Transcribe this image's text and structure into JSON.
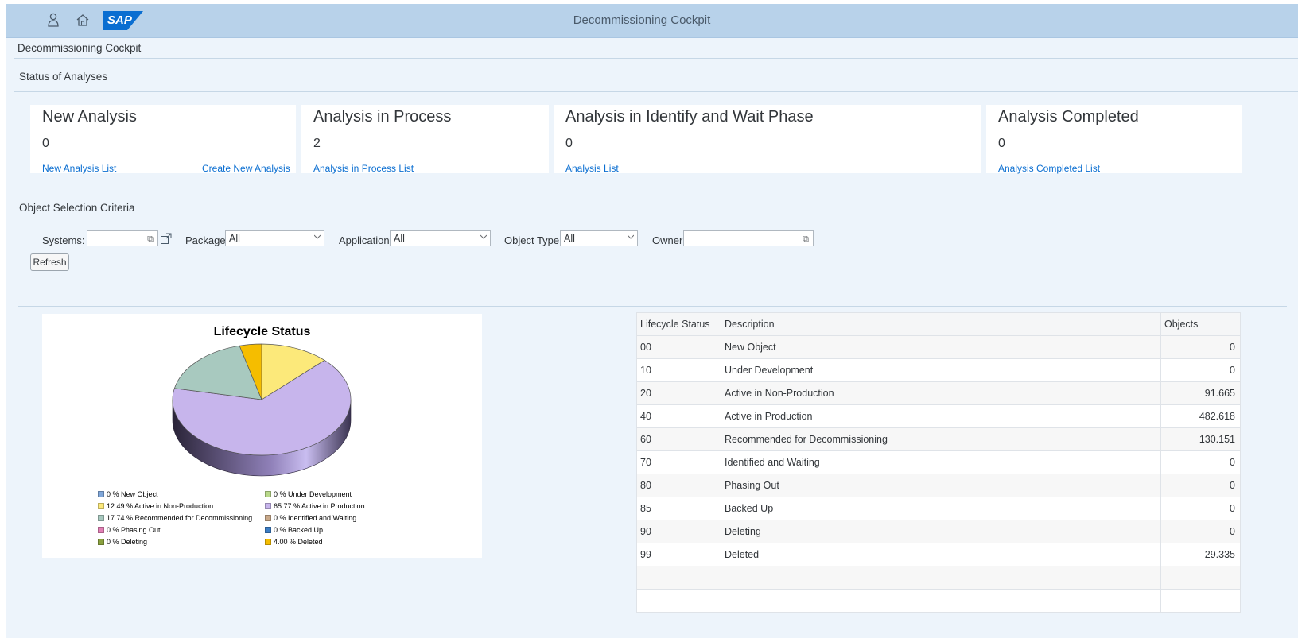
{
  "shell": {
    "title": "Decommissioning Cockpit",
    "logo": "SAP",
    "icons": [
      "user-icon",
      "home-icon"
    ]
  },
  "page_title": "Decommissioning Cockpit",
  "status_section": {
    "title": "Status of Analyses",
    "tiles": [
      {
        "heading": "New Analysis",
        "value": "0",
        "links": [
          "New Analysis List",
          "Create New Analysis"
        ]
      },
      {
        "heading": "Analysis in Process",
        "value": "2",
        "links": [
          "Analysis in Process List"
        ]
      },
      {
        "heading": "Analysis in Identify and Wait Phase",
        "value": "0",
        "links": [
          "Analysis List"
        ]
      },
      {
        "heading": "Analysis Completed",
        "value": "0",
        "links": [
          "Analysis Completed List"
        ]
      }
    ]
  },
  "criteria_section": {
    "title": "Object Selection Criteria",
    "systems_label": "Systems:",
    "systems_value": "",
    "package_label": "Package",
    "package_value": "All",
    "application_label": "Application",
    "application_value": "All",
    "object_type_label": "Object Type",
    "object_type_value": "All",
    "owner_label": "Owner",
    "owner_value": "",
    "refresh_label": "Refresh"
  },
  "chart_data": {
    "type": "pie",
    "title": "Lifecycle Status",
    "slices": [
      {
        "label": "New Object",
        "legend": "0 % New Object",
        "value": 0,
        "color": "#7fa6d9"
      },
      {
        "label": "Under Development",
        "legend": "0 % Under Development",
        "value": 0,
        "color": "#b9d98a"
      },
      {
        "label": "Active in Non-Production",
        "legend": "12.49 % Active in Non-Production",
        "value": 12.49,
        "color": "#fce97a"
      },
      {
        "label": "Active in Production",
        "legend": "65.77 % Active in Production",
        "value": 65.77,
        "color": "#c7b5ec"
      },
      {
        "label": "Recommended for Decommissioning",
        "legend": "17.74 % Recommended for Decommissioning",
        "value": 17.74,
        "color": "#a8c9bf"
      },
      {
        "label": "Identified and Waiting",
        "legend": "0 % Identified and Waiting",
        "value": 0,
        "color": "#c9a98a"
      },
      {
        "label": "Phasing Out",
        "legend": "0 % Phasing Out",
        "value": 0,
        "color": "#e27fb5"
      },
      {
        "label": "Backed Up",
        "legend": "0 % Backed Up",
        "value": 0,
        "color": "#3b7dc4"
      },
      {
        "label": "Deleting",
        "legend": "0 % Deleting",
        "value": 0,
        "color": "#8aa13e"
      },
      {
        "label": "Deleted",
        "legend": "4.00 % Deleted",
        "value": 4.0,
        "color": "#f5bd00"
      }
    ]
  },
  "table": {
    "headers": [
      "Lifecycle Status",
      "Description",
      "Objects"
    ],
    "rows": [
      {
        "status": "00",
        "description": "New Object",
        "objects": "0"
      },
      {
        "status": "10",
        "description": "Under Development",
        "objects": "0"
      },
      {
        "status": "20",
        "description": "Active in Non-Production",
        "objects": "91.665"
      },
      {
        "status": "40",
        "description": "Active in Production",
        "objects": "482.618"
      },
      {
        "status": "60",
        "description": "Recommended for Decommissioning",
        "objects": "130.151"
      },
      {
        "status": "70",
        "description": "Identified and Waiting",
        "objects": "0"
      },
      {
        "status": "80",
        "description": "Phasing Out",
        "objects": "0"
      },
      {
        "status": "85",
        "description": "Backed Up",
        "objects": "0"
      },
      {
        "status": "90",
        "description": "Deleting",
        "objects": "0"
      },
      {
        "status": "99",
        "description": "Deleted",
        "objects": "29.335"
      },
      {
        "status": "",
        "description": "",
        "objects": ""
      },
      {
        "status": "",
        "description": "",
        "objects": ""
      }
    ]
  }
}
